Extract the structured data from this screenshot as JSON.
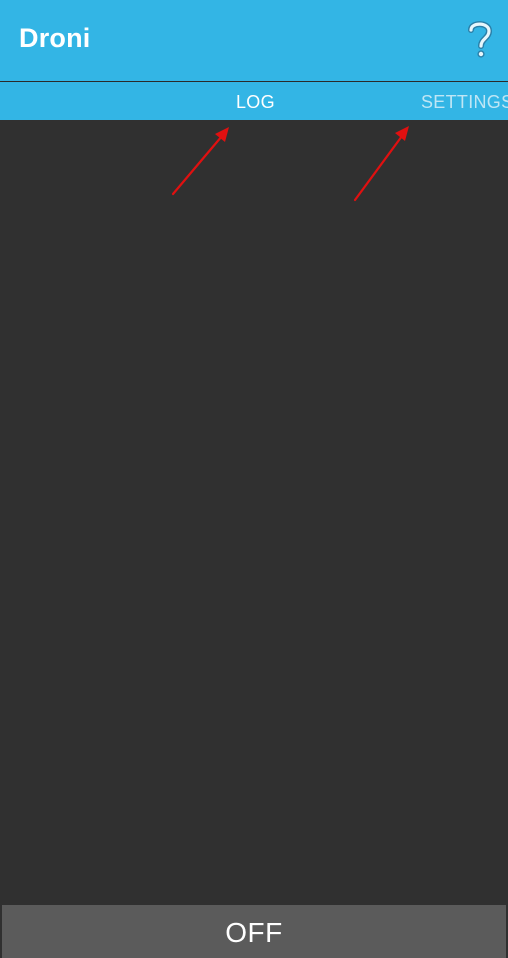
{
  "appbar": {
    "title": "Droni",
    "help_label": "?",
    "background_color": "#33b5e5",
    "help_icon": "question-mark-icon"
  },
  "tabs": [
    {
      "label": "LOG",
      "selected": true
    },
    {
      "label": "SETTINGS",
      "selected": false
    }
  ],
  "log": {
    "background_color": "#303030"
  },
  "toggle": {
    "label": "OFF",
    "background_color": "#5b5b5b"
  },
  "annotations": {
    "arrow_color": "#e01010",
    "arrows": [
      "arrow-pointing-log-tab",
      "arrow-pointing-settings-tab"
    ]
  }
}
